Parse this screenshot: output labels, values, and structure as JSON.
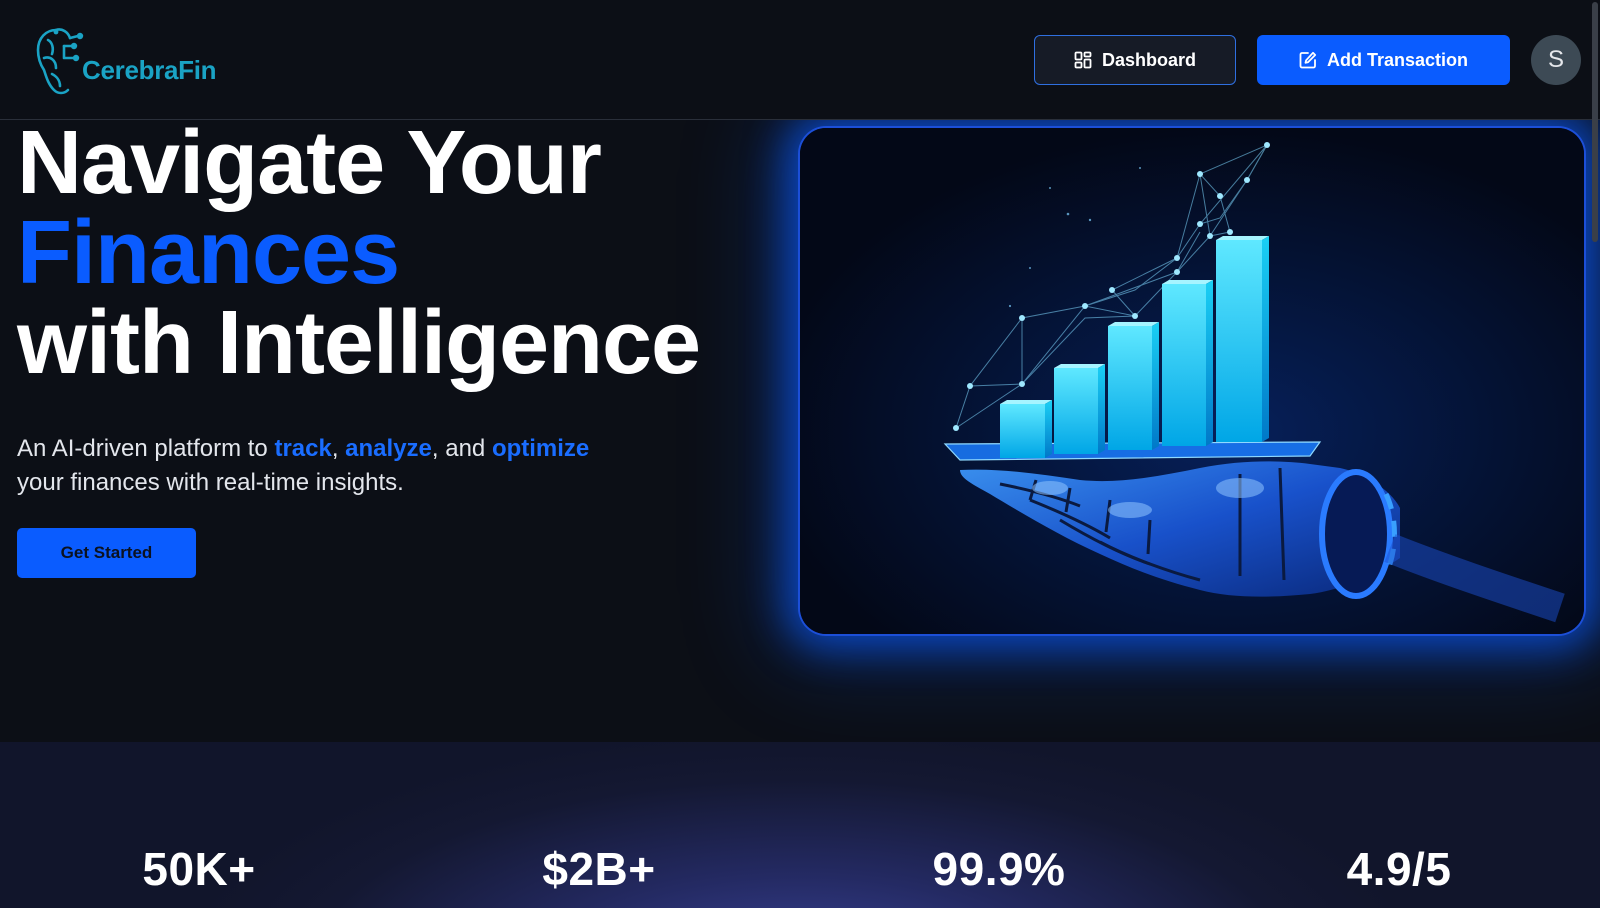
{
  "brand": {
    "name": "CerebraFin"
  },
  "header": {
    "dashboard_label": "Dashboard",
    "add_transaction_label": "Add Transaction",
    "avatar_initial": "S"
  },
  "hero": {
    "title_line1": "Navigate Your",
    "title_line2": "Finances",
    "title_line3": "with Intelligence",
    "desc_part1": "An AI-driven platform to ",
    "desc_track": "track",
    "desc_sep1": ", ",
    "desc_analyze": "analyze",
    "desc_sep2": ", and ",
    "desc_optimize": "optimize",
    "desc_part2": "your finances with real-time insights.",
    "cta_label": "Get Started"
  },
  "stats": [
    {
      "value": "50K+"
    },
    {
      "value": "$2B+"
    },
    {
      "value": "99.9%"
    },
    {
      "value": "4.9/5"
    }
  ],
  "icons": {
    "dashboard": "layout-grid-icon",
    "add_transaction": "pen-square-icon",
    "logo": "brain-circuit-icon"
  },
  "colors": {
    "accent": "#0a5cff",
    "background": "#0c0f16",
    "logo": "#1aa3c5"
  }
}
